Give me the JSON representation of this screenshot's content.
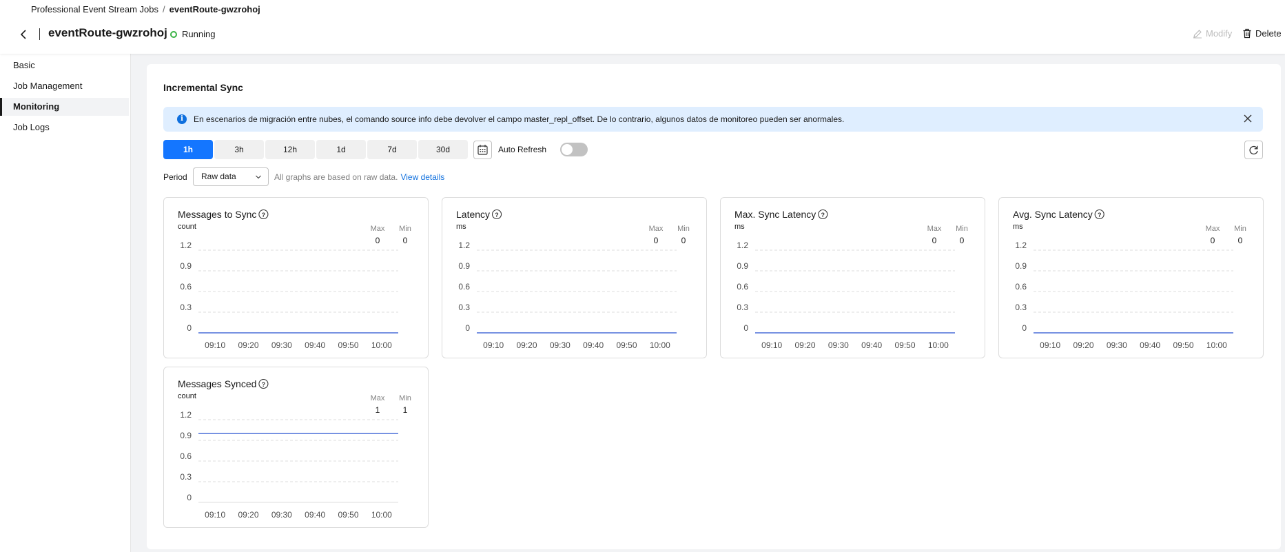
{
  "breadcrumb": {
    "parent": "Professional Event Stream Jobs",
    "separator": "/",
    "current": "eventRoute-gwzrohoj"
  },
  "header": {
    "title": "eventRoute-gwzrohoj",
    "status": "Running",
    "modify_label": "Modify",
    "delete_label": "Delete"
  },
  "colors": {
    "accent": "#1476ff",
    "running": "#3bb346",
    "line": "#4a6fd8",
    "alert_bg": "#dfeeff"
  },
  "sidebar": {
    "items": [
      {
        "label": "Basic",
        "active": false
      },
      {
        "label": "Job Management",
        "active": false
      },
      {
        "label": "Monitoring",
        "active": true
      },
      {
        "label": "Job Logs",
        "active": false
      }
    ]
  },
  "section": {
    "title": "Incremental Sync"
  },
  "alert": {
    "text": "En escenarios de migración entre nubes, el comando source info debe devolver el campo master_repl_offset. De lo contrario, algunos datos de monitoreo pueden ser anormales."
  },
  "time_ranges": [
    "1h",
    "3h",
    "12h",
    "1d",
    "7d",
    "30d"
  ],
  "selected_range": "1h",
  "auto_refresh": {
    "label": "Auto Refresh",
    "enabled": false
  },
  "period": {
    "label": "Period",
    "value": "Raw data",
    "hint": "All graphs are based on raw data.",
    "link": "View details"
  },
  "chart_data": [
    {
      "type": "line",
      "title": "Messages to Sync",
      "unit": "count",
      "max_label": "Max",
      "min_label": "Min",
      "max": "0",
      "min": "0",
      "x": [
        "09:10",
        "09:20",
        "09:30",
        "09:40",
        "09:50",
        "10:00"
      ],
      "y_ticks": [
        "1.2",
        "0.9",
        "0.6",
        "0.3",
        "0"
      ],
      "ylim": [
        0,
        1.2
      ],
      "values": [
        0,
        0,
        0,
        0,
        0,
        0
      ],
      "grid": true
    },
    {
      "type": "line",
      "title": "Latency",
      "unit": "ms",
      "max_label": "Max",
      "min_label": "Min",
      "max": "0",
      "min": "0",
      "x": [
        "09:10",
        "09:20",
        "09:30",
        "09:40",
        "09:50",
        "10:00"
      ],
      "y_ticks": [
        "1.2",
        "0.9",
        "0.6",
        "0.3",
        "0"
      ],
      "ylim": [
        0,
        1.2
      ],
      "values": [
        0,
        0,
        0,
        0,
        0,
        0
      ],
      "grid": true
    },
    {
      "type": "line",
      "title": "Max. Sync Latency",
      "unit": "ms",
      "max_label": "Max",
      "min_label": "Min",
      "max": "0",
      "min": "0",
      "x": [
        "09:10",
        "09:20",
        "09:30",
        "09:40",
        "09:50",
        "10:00"
      ],
      "y_ticks": [
        "1.2",
        "0.9",
        "0.6",
        "0.3",
        "0"
      ],
      "ylim": [
        0,
        1.2
      ],
      "values": [
        0,
        0,
        0,
        0,
        0,
        0
      ],
      "grid": true
    },
    {
      "type": "line",
      "title": "Avg. Sync Latency",
      "unit": "ms",
      "max_label": "Max",
      "min_label": "Min",
      "max": "0",
      "min": "0",
      "x": [
        "09:10",
        "09:20",
        "09:30",
        "09:40",
        "09:50",
        "10:00"
      ],
      "y_ticks": [
        "1.2",
        "0.9",
        "0.6",
        "0.3",
        "0"
      ],
      "ylim": [
        0,
        1.2
      ],
      "values": [
        0,
        0,
        0,
        0,
        0,
        0
      ],
      "grid": true
    },
    {
      "type": "line",
      "title": "Messages Synced",
      "unit": "count",
      "max_label": "Max",
      "min_label": "Min",
      "max": "1",
      "min": "1",
      "x": [
        "09:10",
        "09:20",
        "09:30",
        "09:40",
        "09:50",
        "10:00"
      ],
      "y_ticks": [
        "1.2",
        "0.9",
        "0.6",
        "0.3",
        "0"
      ],
      "ylim": [
        0,
        1.2
      ],
      "values": [
        1,
        1,
        1,
        1,
        1,
        1
      ],
      "grid": true
    }
  ]
}
